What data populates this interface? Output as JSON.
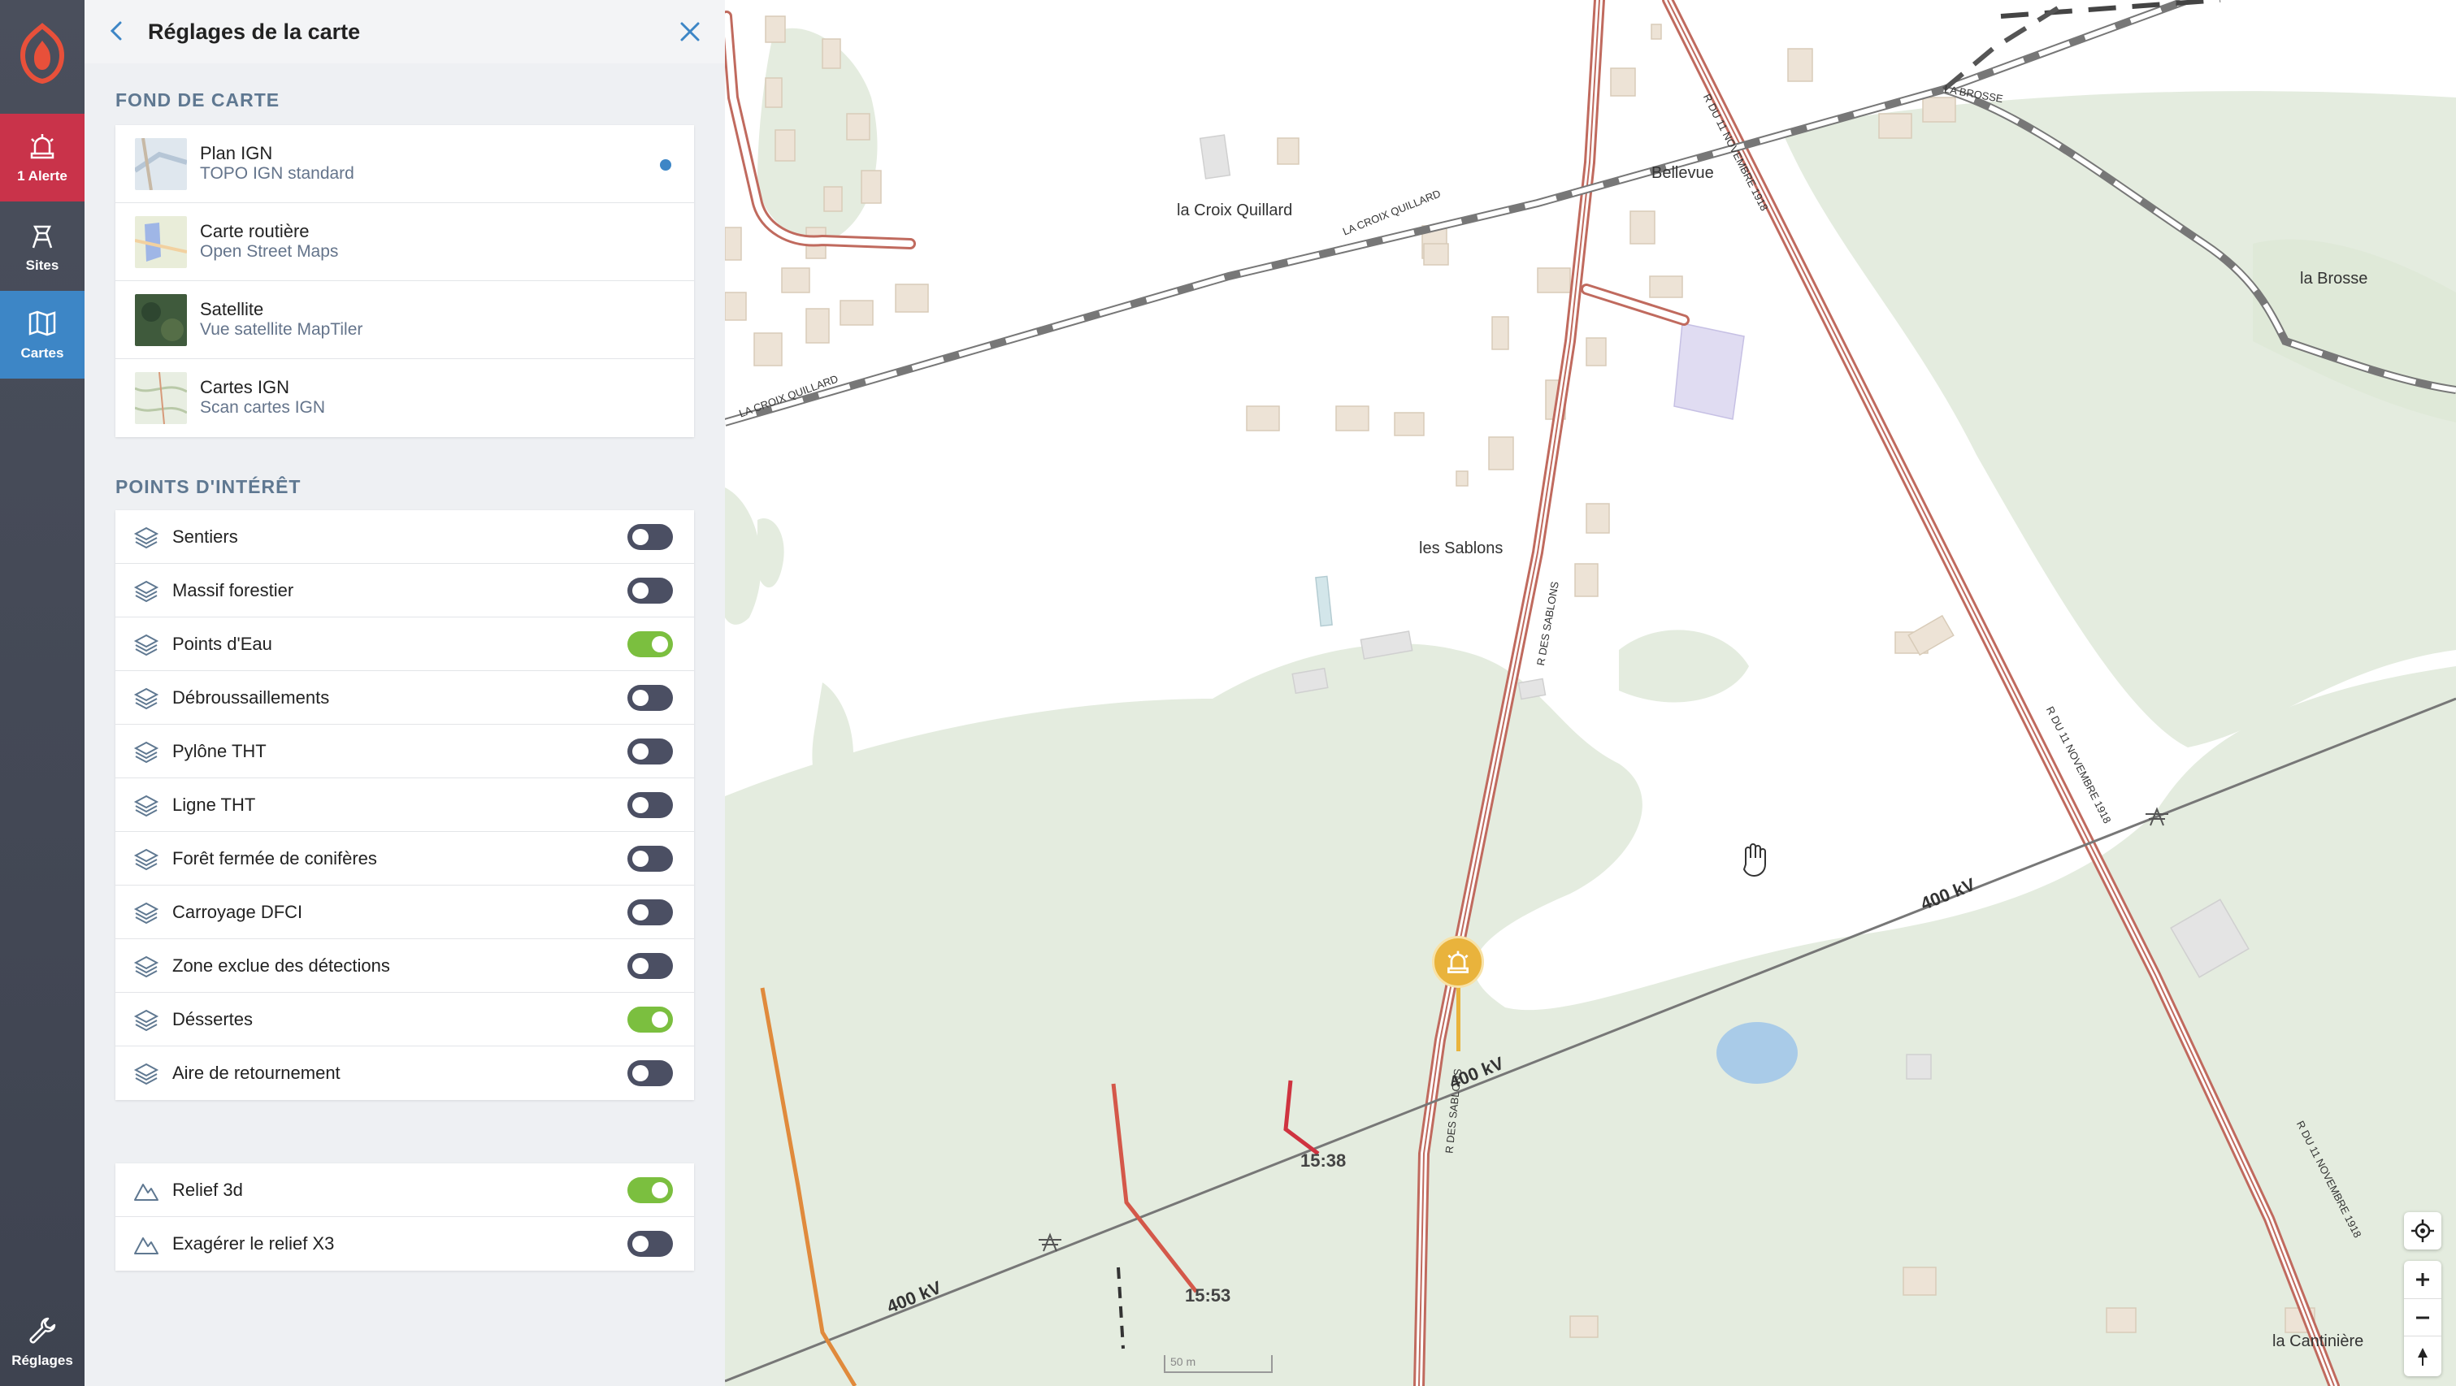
{
  "rail": {
    "alert_label": "1 Alerte",
    "sites_label": "Sites",
    "cartes_label": "Cartes",
    "reglages_label": "Réglages"
  },
  "panel": {
    "title": "Réglages de la carte",
    "basemap_section": "FOND DE CARTE",
    "basemaps": [
      {
        "name": "Plan IGN",
        "sub": "TOPO IGN standard",
        "selected": true
      },
      {
        "name": "Carte routière",
        "sub": "Open Street Maps",
        "selected": false
      },
      {
        "name": "Satellite",
        "sub": "Vue satellite MapTiler",
        "selected": false
      },
      {
        "name": "Cartes IGN",
        "sub": "Scan cartes IGN",
        "selected": false
      }
    ],
    "poi_section": "POINTS D'INTÉRÊT",
    "poi": [
      {
        "label": "Sentiers",
        "on": false
      },
      {
        "label": "Massif forestier",
        "on": false
      },
      {
        "label": "Points d'Eau",
        "on": true
      },
      {
        "label": "Débroussaillements",
        "on": false
      },
      {
        "label": "Pylône THT",
        "on": false
      },
      {
        "label": "Ligne THT",
        "on": false
      },
      {
        "label": "Forêt fermée de conifères",
        "on": false
      },
      {
        "label": "Carroyage DFCI",
        "on": false
      },
      {
        "label": "Zone exclue des détections",
        "on": false
      },
      {
        "label": "Déssertes",
        "on": true
      },
      {
        "label": "Aire de retournement",
        "on": false
      }
    ],
    "relief": [
      {
        "label": "Relief 3d",
        "on": true
      },
      {
        "label": "Exagérer le relief X3",
        "on": false
      }
    ]
  },
  "map": {
    "places": {
      "croix": "la Croix Quillard",
      "bellevue": "Bellevue",
      "brosse": "la Brosse",
      "sablons": "les Sablons",
      "cantiniere": "la Cantinière"
    },
    "roads": {
      "croix1": "LA CROIX QUILLARD",
      "croix2": "LA CROIX QUILLARD",
      "brosse": "LA BROSSE",
      "sablons1": "R DES SABLONS",
      "sablons2": "R DES SABLONS",
      "nov1": "R DU 11 NOVEMBRE 1918",
      "nov2": "R DU 11 NOVEMBRE 1918",
      "nov3": "R DU 11 NOVEMBRE 1918"
    },
    "line_labels": [
      "400 kV",
      "400 kV",
      "400 kV"
    ],
    "times": [
      "15:38",
      "15:53"
    ],
    "scale": "50 m"
  },
  "colors": {
    "rail": "#454a57",
    "alert": "#c9334a",
    "active": "#3d86c6",
    "toggle_on": "#7bbf3f",
    "toggle_off": "#4b4f63",
    "forest": "#e4ecdf",
    "marker": "#e9b33c"
  }
}
